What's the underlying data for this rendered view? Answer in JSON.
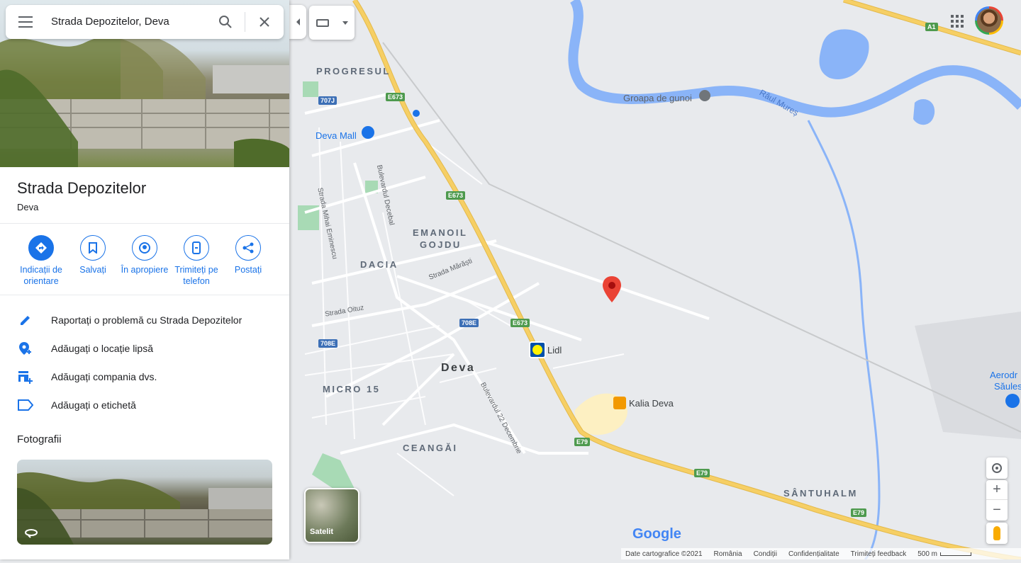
{
  "search": {
    "query": "Strada Depozitelor, Deva"
  },
  "place": {
    "title": "Strada Depozitelor",
    "subtitle": "Deva"
  },
  "actions": [
    {
      "label_line1": "Indicații de",
      "label_line2": "orientare",
      "icon": "directions-icon"
    },
    {
      "label_line1": "Salvați",
      "label_line2": "",
      "icon": "bookmark-icon"
    },
    {
      "label_line1": "În apropiere",
      "label_line2": "",
      "icon": "nearby-icon"
    },
    {
      "label_line1": "Trimiteți pe",
      "label_line2": "telefon",
      "icon": "send-to-phone-icon"
    },
    {
      "label_line1": "Postați",
      "label_line2": "",
      "icon": "share-icon"
    }
  ],
  "rows": [
    {
      "label": "Raportați o problemă cu Strada Depozitelor",
      "icon": "edit-icon"
    },
    {
      "label": "Adăugați o locație lipsă",
      "icon": "add-location-icon"
    },
    {
      "label": "Adăugați compania dvs.",
      "icon": "add-business-icon"
    },
    {
      "label": "Adăugați o etichetă",
      "icon": "label-icon"
    }
  ],
  "photos": {
    "title": "Fotografii"
  },
  "map": {
    "districts": {
      "progresul": "PROGRESUL",
      "emanoil": "EMANOIL",
      "gojdu": "GOJDU",
      "dacia": "DACIA",
      "micro15": "MICRO 15",
      "ceangai": "CEANGĂI",
      "santuhalm": "SÂNTUHALM",
      "deva": "Deva"
    },
    "pois": {
      "groapa": "Groapa de gunoi",
      "devamall": "Deva Mall",
      "lidl": "Lidl",
      "kalia": "Kalia Deva",
      "aerodrom1": "Aerodr",
      "aerodrom2": "Săules",
      "river": "Râul Mureș"
    },
    "streets": {
      "decebal": "Bulevardul Decebal",
      "eminescu": "Strada Mihai Eminescu",
      "marasti": "Strada Mărăști",
      "oituz": "Strada Oituz",
      "dec22": "Bulevardul 22 Decembrie"
    },
    "shields": {
      "e673a": "E673",
      "e673b": "E673",
      "e673c": "E673",
      "s707j": "707J",
      "s708e1": "708E",
      "s708e2": "708E",
      "e79a": "E79",
      "e79b": "E79",
      "e79c": "E79",
      "a1": "A1"
    },
    "layer_label": "Satelit",
    "logo": "Google"
  },
  "footer": {
    "data": "Date cartografice ©2021",
    "country": "România",
    "terms": "Condiții",
    "privacy": "Confidențialitate",
    "feedback": "Trimiteți feedback",
    "scale": "500 m"
  },
  "colors": {
    "accent": "#1a73e8",
    "highway": "#f6cf65",
    "water": "#8ab4f8",
    "park": "#a8dab5",
    "pin": "#ea4335"
  }
}
